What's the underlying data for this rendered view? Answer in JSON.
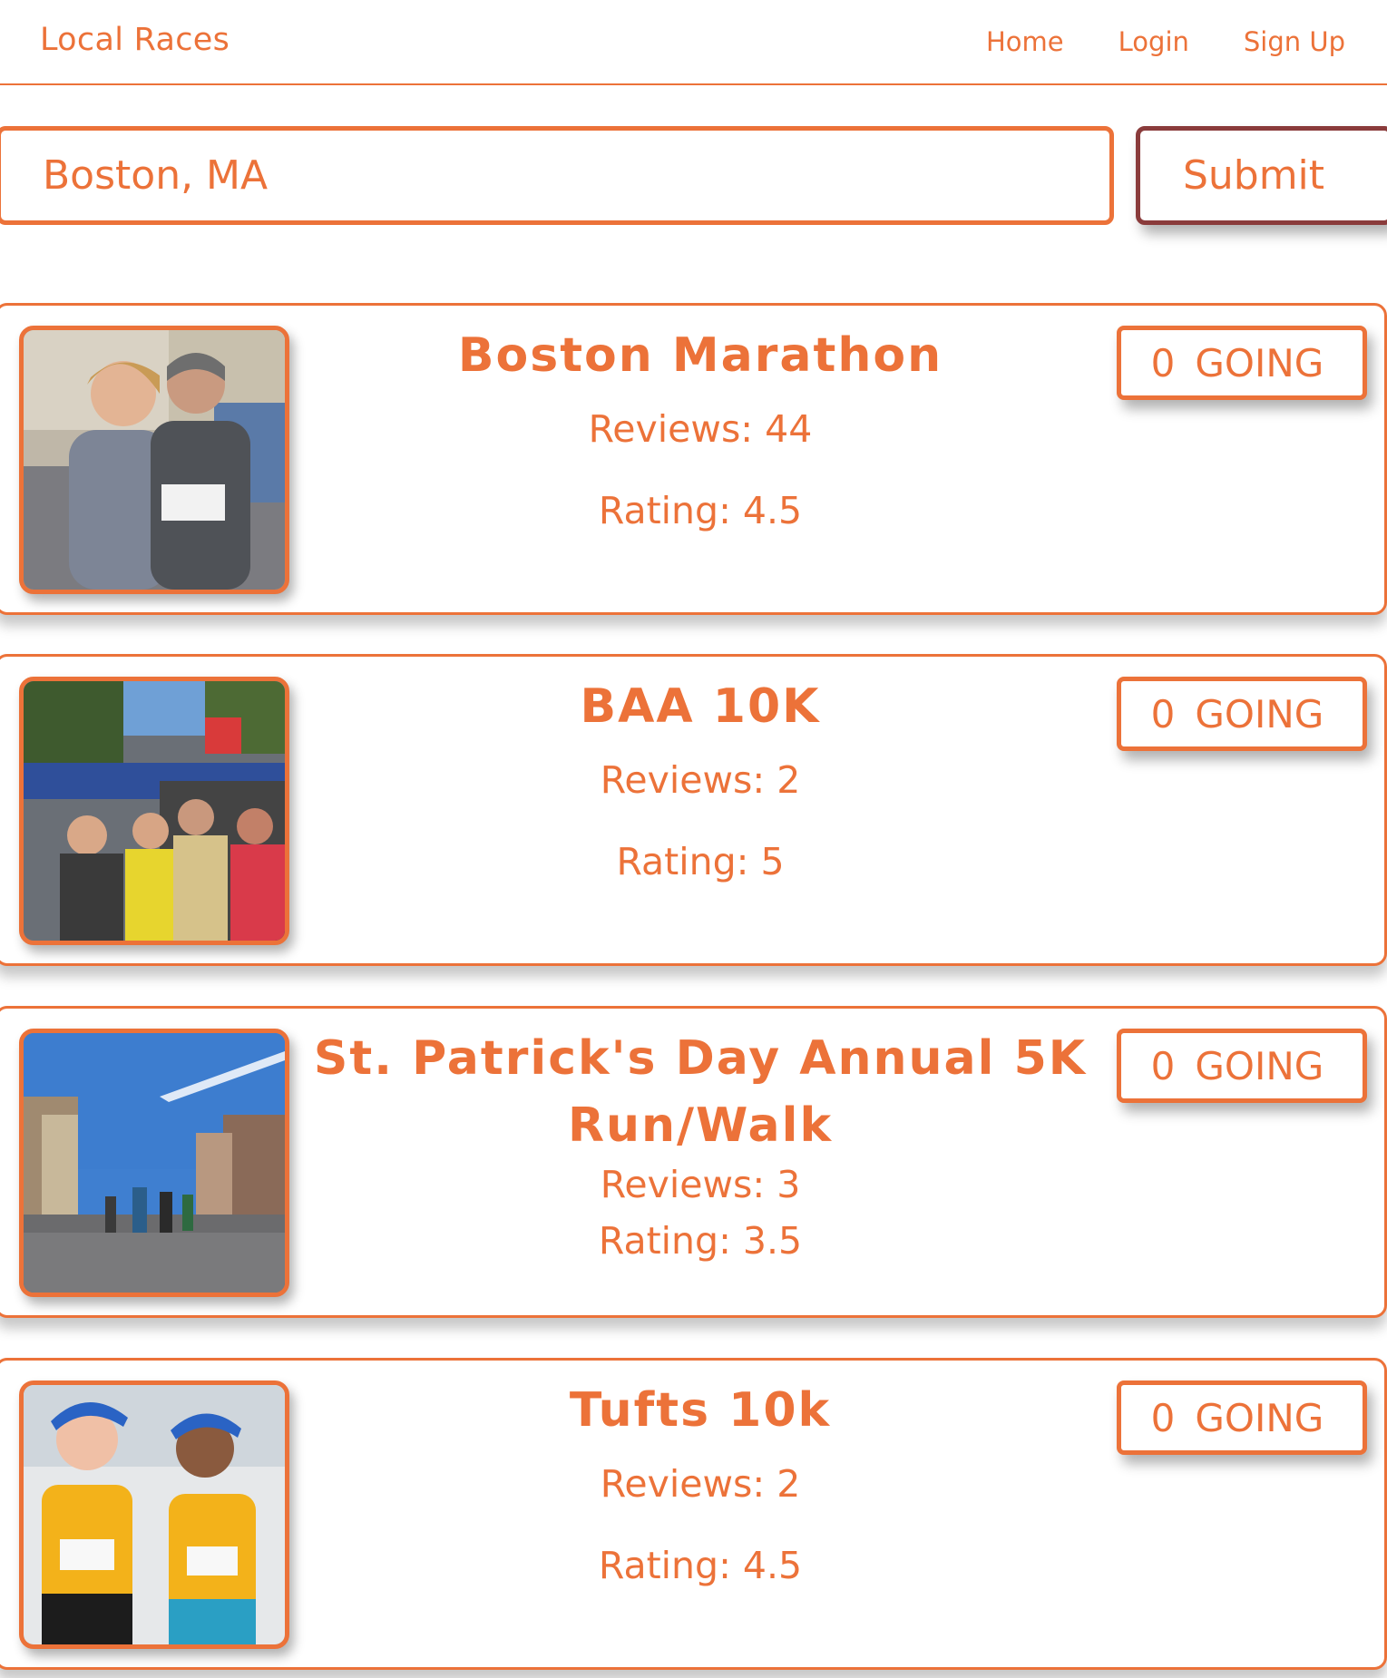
{
  "navbar": {
    "brand": "Local Races",
    "links": [
      "Home",
      "Login",
      "Sign Up"
    ]
  },
  "search": {
    "value": "Boston, MA",
    "submit_label": "Submit"
  },
  "races": [
    {
      "title": "Boston Marathon",
      "reviews": "Reviews: 44",
      "rating": "Rating: 4.5",
      "going_count": "0",
      "going_label": "GOING"
    },
    {
      "title": "BAA 10K",
      "reviews": "Reviews: 2",
      "rating": "Rating: 5",
      "going_count": "0",
      "going_label": "GOING"
    },
    {
      "title": "St. Patrick's Day Annual 5K Run/Walk",
      "reviews": "Reviews: 3",
      "rating": "Rating: 3.5",
      "going_count": "0",
      "going_label": "GOING"
    },
    {
      "title": "Tufts 10k",
      "reviews": "Reviews: 2",
      "rating": "Rating: 4.5",
      "going_count": "0",
      "going_label": "GOING"
    }
  ],
  "colors": {
    "accent": "#ec7239",
    "submit_border": "#8a3b3b",
    "background": "#ffffff"
  }
}
